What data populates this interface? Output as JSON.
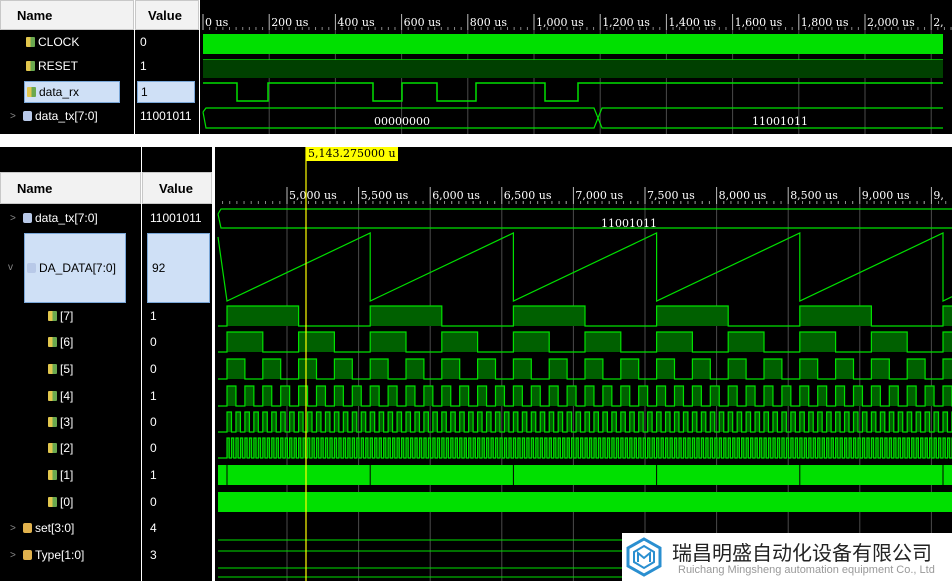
{
  "top": {
    "name_header": "Name",
    "value_header": "Value",
    "time_ticks": [
      "0 us",
      "200 us",
      "400 us",
      "600 us",
      "800 us",
      "1,000 us",
      "1,200 us",
      "1,400 us",
      "1,600 us",
      "1,800 us",
      "2,000 us",
      "2,"
    ],
    "signals": [
      {
        "name": "CLOCK",
        "value": "0",
        "kind": "signal"
      },
      {
        "name": "RESET",
        "value": "1",
        "kind": "signal"
      },
      {
        "name": "data_rx",
        "value": "1",
        "kind": "signal",
        "selected": true
      },
      {
        "name": "data_tx[7:0]",
        "value": "11001011",
        "kind": "bus",
        "expandable": true
      }
    ],
    "bus_values": [
      "00000000",
      "11001011"
    ]
  },
  "bottom": {
    "name_header": "Name",
    "value_header": "Value",
    "cursor_time": "5,143.275000 u",
    "time_ticks": [
      "5,000 us",
      "5,500 us",
      "6,000 us",
      "6,500 us",
      "7,000 us",
      "7,500 us",
      "8,000 us",
      "8,500 us",
      "9,000 us",
      "9,"
    ],
    "signals": [
      {
        "name": "data_tx[7:0]",
        "value": "11001011",
        "kind": "bus",
        "expander": ">"
      },
      {
        "name": "DA_DATA[7:0]",
        "value": "92",
        "kind": "bus",
        "expander": "v",
        "selected": true
      },
      {
        "name": "[7]",
        "value": "1",
        "kind": "signal"
      },
      {
        "name": "[6]",
        "value": "0",
        "kind": "signal"
      },
      {
        "name": "[5]",
        "value": "0",
        "kind": "signal"
      },
      {
        "name": "[4]",
        "value": "1",
        "kind": "signal"
      },
      {
        "name": "[3]",
        "value": "0",
        "kind": "signal"
      },
      {
        "name": "[2]",
        "value": "0",
        "kind": "signal"
      },
      {
        "name": "[1]",
        "value": "1",
        "kind": "signal"
      },
      {
        "name": "[0]",
        "value": "0",
        "kind": "signal"
      },
      {
        "name": "set[3:0]",
        "value": "4",
        "kind": "group",
        "expander": ">"
      },
      {
        "name": "Type[1:0]",
        "value": "3",
        "kind": "group",
        "expander": ">"
      }
    ],
    "bus_value": "11001011"
  },
  "watermark": {
    "company_cn": "瑞昌明盛自动化设备有限公司",
    "company_en": "Ruichang Mingsheng automation equipment Co., Ltd"
  },
  "colors": {
    "wave": "#00e000",
    "cursor": "#ffff00",
    "grid": "#5a5a5a"
  }
}
